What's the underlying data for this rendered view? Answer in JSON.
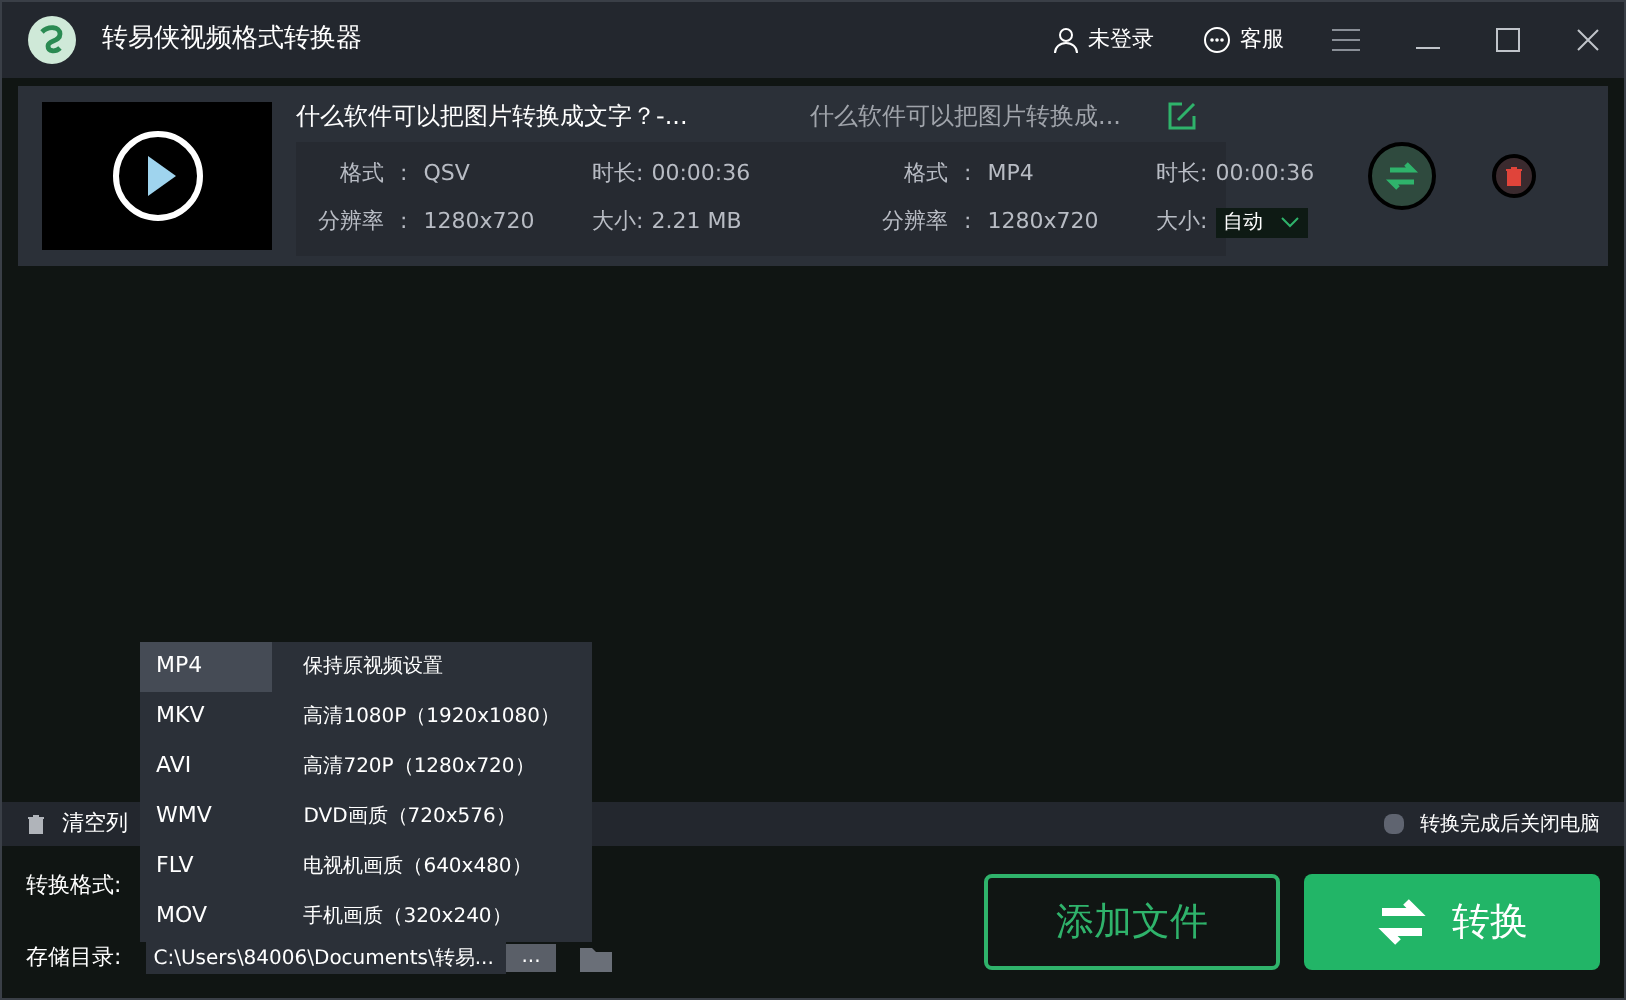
{
  "window": {
    "title": "转易侠视频格式转换器"
  },
  "header_actions": [
    {
      "kind": "user",
      "label": "未登录"
    },
    {
      "kind": "chat",
      "label": "客服"
    }
  ],
  "files": [
    {
      "name": "什么软件可以把图片转换成文字？-...",
      "output_name": "什么软件可以把图片转换成...",
      "source": {
        "format_label": "格式",
        "sep": ":",
        "format": "QSV",
        "resolution_label": "分辨率",
        "resolution": "1280x720",
        "duration_label": "时长:",
        "duration": "00:00:36",
        "size_label": "大小:",
        "size": "2.21 MB"
      },
      "target": {
        "format_label": "格式",
        "sep": ":",
        "format": "MP4",
        "resolution_label": "分辨率",
        "resolution": "1280x720",
        "duration_label": "时长:",
        "duration": "00:00:36",
        "size_label": "大小:",
        "size": "自动"
      }
    }
  ],
  "toolbar": {
    "clear_list": "清空列",
    "shutdown": {
      "label": "转换完成后关闭电脑",
      "checked": false
    }
  },
  "format_label": "转换格式:",
  "output_label": "存储目录:",
  "output_path": "C:\\Users\\84006\\Documents\\转易...",
  "browse": "...",
  "format_menu": {
    "formats": [
      {
        "label": "MP4",
        "selected": true
      },
      {
        "label": "MKV",
        "selected": false
      },
      {
        "label": "AVI",
        "selected": false
      },
      {
        "label": "WMV",
        "selected": false
      },
      {
        "label": "FLV",
        "selected": false
      },
      {
        "label": "MOV",
        "selected": false
      }
    ],
    "presets": [
      "保持原视频设置",
      "高清1080P（1920x1080）",
      "高清720P（1280x720）",
      "DVD画质（720x576）",
      "电视机画质（640x480）",
      "手机画质（320x240）"
    ]
  },
  "buttons": {
    "add": "添加文件",
    "convert": "转换"
  }
}
